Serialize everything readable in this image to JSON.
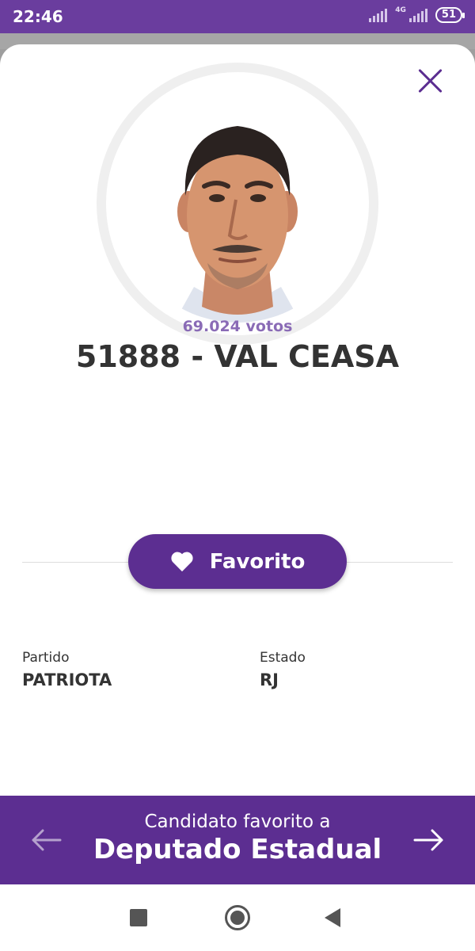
{
  "status_bar": {
    "time": "22:46",
    "network": "4G",
    "battery": "51",
    "icons": [
      "signal-icon",
      "signal-4g-icon",
      "battery-icon"
    ]
  },
  "candidate": {
    "votes": "69.024 votos",
    "name": "51888 - VAL CEASA",
    "photo_icon": "candidate-photo"
  },
  "favorite_button": {
    "label": "Favorito",
    "icon": "heart-icon"
  },
  "details": {
    "party_label": "Partido",
    "party_value": "PATRIOTA",
    "state_label": "Estado",
    "state_value": "RJ"
  },
  "footer": {
    "caption": "Candidato favorito a",
    "title": "Deputado Estadual",
    "prev_icon": "arrow-left-icon",
    "next_icon": "arrow-right-icon"
  },
  "colors": {
    "primary": "#5c2e91",
    "status_bar": "#6a3d9e",
    "votes_text": "#8a6bb6",
    "text": "#333333"
  },
  "navigation": {
    "icons": [
      "recents-icon",
      "home-icon",
      "back-icon"
    ]
  }
}
